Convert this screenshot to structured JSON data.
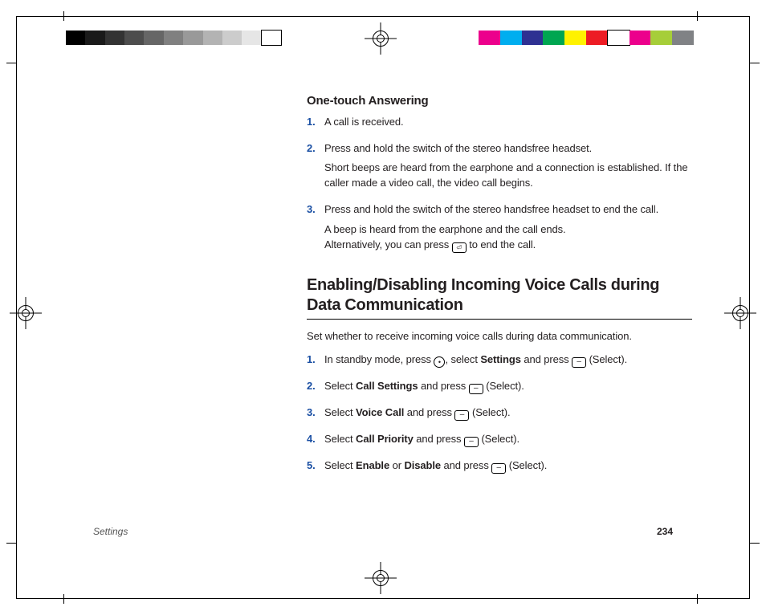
{
  "section1": {
    "heading": "One-touch Answering",
    "steps": [
      {
        "num": "1.",
        "paras": [
          "A call is received."
        ]
      },
      {
        "num": "2.",
        "paras": [
          "Press and hold the switch of the stereo handsfree headset.",
          "Short beeps are heard from the earphone and a connection is established. If the caller made a video call, the video call begins."
        ]
      },
      {
        "num": "3.",
        "paras": [
          "Press and hold the switch of the stereo handsfree headset to end the call.",
          "A beep is heard from the earphone and the call ends. Alternatively, you can press [end] to end the call."
        ]
      }
    ]
  },
  "section2": {
    "heading": "Enabling/Disabling Incoming Voice Calls during Data Communication",
    "intro": "Set whether to receive incoming voice calls during data communication.",
    "steps": [
      {
        "num": "1.",
        "pre": "In standby mode, press ",
        "mid_bold": "Settings",
        "mid": ", select ",
        "post": " and press ",
        "suffix": " (Select)."
      },
      {
        "num": "2.",
        "pre": "Select ",
        "bold": "Call Settings",
        "post": " and press ",
        "suffix": " (Select)."
      },
      {
        "num": "3.",
        "pre": "Select ",
        "bold": "Voice Call",
        "post": " and press ",
        "suffix": " (Select)."
      },
      {
        "num": "4.",
        "pre": "Select ",
        "bold": "Call Priority",
        "post": " and press ",
        "suffix": " (Select)."
      },
      {
        "num": "5.",
        "pre": "Select ",
        "bold": "Enable",
        "or": " or ",
        "bold2": "Disable",
        "post": " and press ",
        "suffix": " (Select)."
      }
    ]
  },
  "footer": {
    "section": "Settings",
    "page": "234"
  },
  "colorbar_left": [
    "#000000",
    "#1a1a1a",
    "#333333",
    "#4d4d4d",
    "#666666",
    "#808080",
    "#999999",
    "#b3b3b3",
    "#cccccc",
    "#e6e6e6",
    "#ffffff"
  ],
  "colorbar_right": [
    "#ec008c",
    "#00aeef",
    "#2e3192",
    "#00a651",
    "#fff200",
    "#ed1c24",
    "#ffffff",
    "#ec008c",
    "#a6ce39",
    "#808285"
  ]
}
